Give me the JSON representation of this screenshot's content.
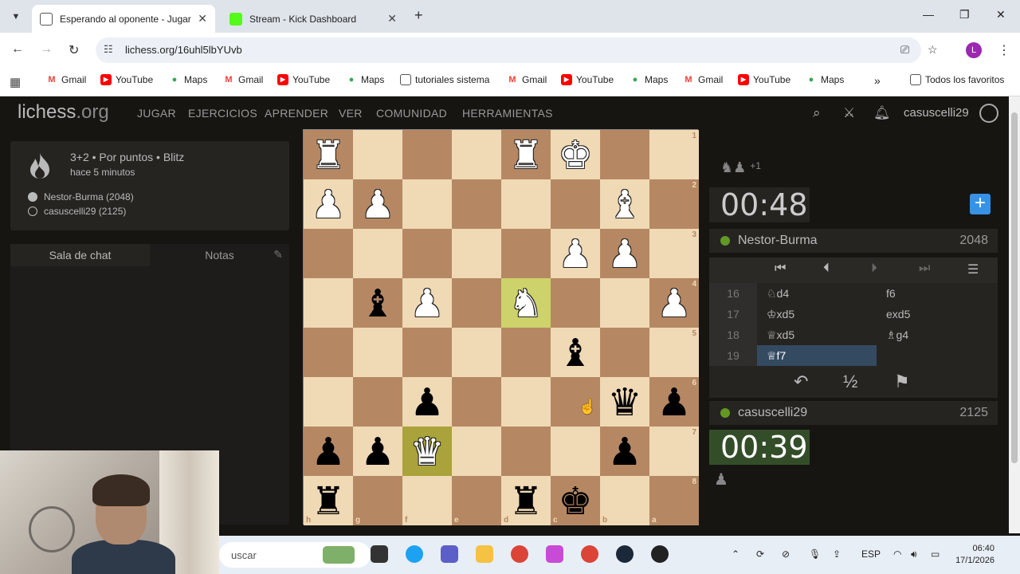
{
  "browser": {
    "tabs": [
      {
        "title": "Esperando al oponente - Jugar",
        "active": true
      },
      {
        "title": "Stream - Kick Dashboard",
        "active": false
      }
    ],
    "url": "lichess.org/16uhl5lbYUvb",
    "profile_letter": "L",
    "bookmarks": [
      "Gmail",
      "YouTube",
      "Maps",
      "Gmail",
      "YouTube",
      "Maps",
      "tutoriales sistema",
      "Gmail",
      "YouTube",
      "Maps",
      "Gmail",
      "YouTube",
      "Maps"
    ],
    "all_bookmarks": "Todos los favoritos",
    "colors": {
      "gmail": "#ea4335",
      "youtube": "#ff0000",
      "maps": "#34a853",
      "folder": "#555555"
    }
  },
  "site": {
    "logo_main": "lichess",
    "logo_tld": ".org",
    "nav": [
      "JUGAR",
      "EJERCICIOS",
      "APRENDER",
      "VER",
      "COMUNIDAD",
      "HERRAMIENTAS"
    ],
    "username": "casuscelli29",
    "icons": [
      "search-icon",
      "swords-icon",
      "bell-icon",
      "user-icon"
    ]
  },
  "game": {
    "type": "3+2 • Por puntos • Blitz",
    "ago": "hace 5 minutos",
    "white_player": "Nestor-Burma (2048)",
    "black_player": "casuscelli29 (2125)"
  },
  "chat": {
    "tab_chat": "Sala de chat",
    "tab_notes": "Notas"
  },
  "board": {
    "orientation": "black",
    "rank_labels": [
      "1",
      "2",
      "3",
      "4",
      "5",
      "6",
      "7",
      "8"
    ],
    "file_labels": [
      "h",
      "g",
      "f",
      "e",
      "d",
      "c",
      "b",
      "a"
    ],
    "highlight_squares": [
      "d4",
      "f7"
    ],
    "pieces": [
      {
        "square": "h1",
        "glyph": "♜",
        "color": "white"
      },
      {
        "square": "d1",
        "glyph": "♜",
        "color": "white"
      },
      {
        "square": "c1",
        "glyph": "♚",
        "color": "white"
      },
      {
        "square": "h2",
        "glyph": "♟",
        "color": "white"
      },
      {
        "square": "g2",
        "glyph": "♟",
        "color": "white"
      },
      {
        "square": "b2",
        "glyph": "♝",
        "color": "white"
      },
      {
        "square": "c3",
        "glyph": "♟",
        "color": "white"
      },
      {
        "square": "b3",
        "glyph": "♟",
        "color": "white"
      },
      {
        "square": "g4",
        "glyph": "♝",
        "color": "black"
      },
      {
        "square": "f4",
        "glyph": "♟",
        "color": "white"
      },
      {
        "square": "d4",
        "glyph": "♞",
        "color": "white"
      },
      {
        "square": "a4",
        "glyph": "♟",
        "color": "white"
      },
      {
        "square": "c5",
        "glyph": "♝",
        "color": "black"
      },
      {
        "square": "f6",
        "glyph": "♟",
        "color": "black"
      },
      {
        "square": "b6",
        "glyph": "♛",
        "color": "black"
      },
      {
        "square": "a6",
        "glyph": "♟",
        "color": "black"
      },
      {
        "square": "h7",
        "glyph": "♟",
        "color": "black"
      },
      {
        "square": "g7",
        "glyph": "♟",
        "color": "black"
      },
      {
        "square": "f7",
        "glyph": "♛",
        "color": "white"
      },
      {
        "square": "b7",
        "glyph": "♟",
        "color": "black"
      },
      {
        "square": "h8",
        "glyph": "♜",
        "color": "black"
      },
      {
        "square": "d8",
        "glyph": "♜",
        "color": "black"
      },
      {
        "square": "c8",
        "glyph": "♚",
        "color": "black"
      }
    ],
    "colors": {
      "light": "#f0d9b5",
      "dark": "#b58863",
      "highlight_light": "#cdd26a",
      "highlight_dark": "#aaa23b"
    }
  },
  "right": {
    "material": "+1",
    "top_clock": "00:48",
    "top_player": {
      "name": "Nestor-Burma",
      "rating": "2048"
    },
    "bottom_player": {
      "name": "casuscelli29",
      "rating": "2125"
    },
    "bottom_clock": "00:39",
    "moves": [
      {
        "num": "16",
        "white": "♘d4",
        "black": "f6"
      },
      {
        "num": "17",
        "white": "♔xd5",
        "black": "exd5"
      },
      {
        "num": "18",
        "white": "♕xd5",
        "black": "♗g4"
      },
      {
        "num": "19",
        "white": "♕f7",
        "black": ""
      }
    ],
    "draw": "½"
  },
  "taskbar": {
    "search_placeholder": "uscar",
    "lang": "ESP",
    "time": "06:40",
    "date": "17/1/2026"
  }
}
